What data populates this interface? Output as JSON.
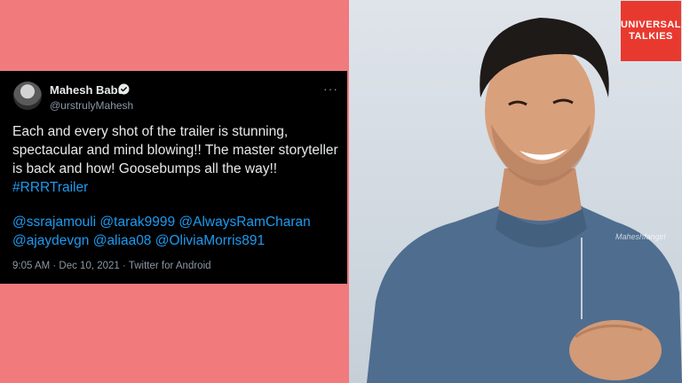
{
  "tweet": {
    "author_name": "Mahesh Babu",
    "handle": "@urstrulyMahesh",
    "more_icon": "more-icon",
    "verified_icon": "verified-badge-icon",
    "text_main": "Each and every shot of the trailer is stunning, spectacular and mind blowing!! The master storyteller is back and how! Goosebumps all the way!! ",
    "hashtag": "#RRRTrailer",
    "mentions_line1": "@ssrajamouli @tarak9999 @AlwaysRamCharan",
    "mentions_line2": "@ajaydevgn @aliaa08 @OliviaMorris891",
    "timestamp": "9:05 AM · Dec 10, 2021 · Twitter for Android"
  },
  "photo": {
    "watermark": "Maheshfangirl"
  },
  "brand": {
    "line1": "UNIVERSAL",
    "line2": "TALKIES"
  },
  "colors": {
    "background": "#f17a7d",
    "tweet_bg": "#000000",
    "link": "#1d9bf0",
    "brand_red": "#e8392f"
  }
}
